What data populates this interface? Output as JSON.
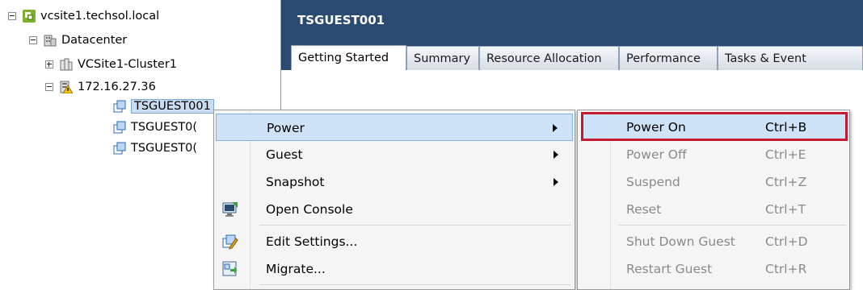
{
  "tree": {
    "root": "vcsite1.techsol.local",
    "datacenter": "Datacenter",
    "cluster": "VCSite1-Cluster1",
    "host": "172.16.27.36",
    "vms": [
      "TSGUEST001",
      "TSGUEST0(",
      "TSGUEST0("
    ]
  },
  "header": {
    "title": "TSGUEST001",
    "tabs": [
      "Getting Started",
      "Summary",
      "Resource Allocation",
      "Performance",
      "Tasks & Event"
    ],
    "active_tab": "Getting Started"
  },
  "context_menu": {
    "items": [
      {
        "label": "Power",
        "submenu": true,
        "highlighted": true,
        "icon": null
      },
      {
        "label": "Guest",
        "submenu": true,
        "icon": null
      },
      {
        "label": "Snapshot",
        "submenu": true,
        "icon": null
      },
      {
        "label": "Open Console",
        "icon": "console-icon"
      },
      {
        "label": "Edit Settings...",
        "icon": "edit-settings-icon"
      },
      {
        "label": "Migrate...",
        "icon": "migrate-icon"
      }
    ]
  },
  "power_submenu": {
    "items": [
      {
        "label": "Power On",
        "shortcut": "Ctrl+B",
        "enabled": true,
        "highlighted": true
      },
      {
        "label": "Power Off",
        "shortcut": "Ctrl+E",
        "enabled": false
      },
      {
        "label": "Suspend",
        "shortcut": "Ctrl+Z",
        "enabled": false
      },
      {
        "label": "Reset",
        "shortcut": "Ctrl+T",
        "enabled": false
      },
      {
        "label": "Shut Down Guest",
        "shortcut": "Ctrl+D",
        "enabled": false
      },
      {
        "label": "Restart Guest",
        "shortcut": "Ctrl+R",
        "enabled": false
      }
    ]
  },
  "colors": {
    "header_bg": "#2b4a72",
    "highlight_bg": "#cfe3f8",
    "callout_border": "#c4192f"
  }
}
